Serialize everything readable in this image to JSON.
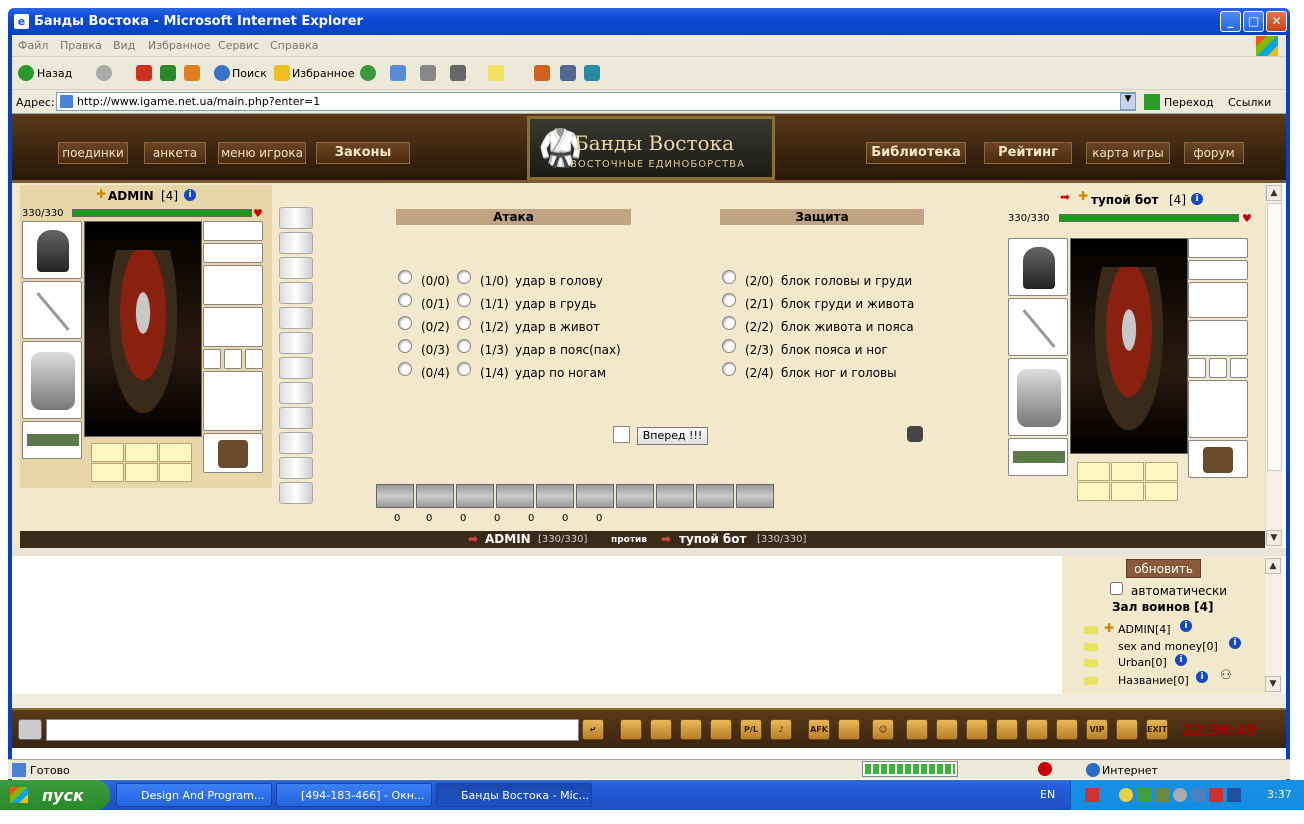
{
  "window": {
    "title": "Банды Востока - Microsoft Internet Explorer"
  },
  "menu": [
    "Файл",
    "Правка",
    "Вид",
    "Избранное",
    "Сервис",
    "Справка"
  ],
  "toolbar": {
    "back": "Назад",
    "search": "Поиск",
    "favorites": "Избранное"
  },
  "address": {
    "label": "Адрес:",
    "url": "http://www.igame.net.ua/main.php?enter=1",
    "go": "Переход",
    "links": "Ссылки"
  },
  "game_nav": {
    "left": [
      "поединки",
      "анкета",
      "меню игрока",
      "Законы"
    ],
    "right": [
      "Библиотека",
      "Рейтинг",
      "карта игры",
      "форум"
    ],
    "logo_title": "Банды Востока",
    "logo_sub": "ВОСТОЧНЫЕ ЕДИНОБОРСТВА"
  },
  "player": {
    "name": "ADMIN",
    "level": "[4]",
    "hp": "330/330",
    "hp_fraction": 1.0
  },
  "opponent": {
    "name": "тупой бот",
    "level": "[4]",
    "hp": "330/330",
    "hp_fraction": 1.0
  },
  "attack": {
    "header": "Атака",
    "rows": [
      {
        "code_a": "(0/0)",
        "code_b": "(1/0)",
        "label": "удар в голову"
      },
      {
        "code_a": "(0/1)",
        "code_b": "(1/1)",
        "label": "удар в грудь"
      },
      {
        "code_a": "(0/2)",
        "code_b": "(1/2)",
        "label": "удар в живот"
      },
      {
        "code_a": "(0/3)",
        "code_b": "(1/3)",
        "label": "удар в пояс(пах)"
      },
      {
        "code_a": "(0/4)",
        "code_b": "(1/4)",
        "label": "удар по ногам"
      }
    ]
  },
  "defense": {
    "header": "Защита",
    "rows": [
      {
        "code": "(2/0)",
        "label": "блок головы и груди"
      },
      {
        "code": "(2/1)",
        "label": "блок груди и живота"
      },
      {
        "code": "(2/2)",
        "label": "блок живота и пояса"
      },
      {
        "code": "(2/3)",
        "label": "блок пояса и ног"
      },
      {
        "code": "(2/4)",
        "label": "блок ног и головы"
      }
    ]
  },
  "forward_button": "Вперед !!!",
  "counters": [
    "0",
    "0",
    "0",
    "0",
    "0",
    "0",
    "0"
  ],
  "versus": {
    "p1": "ADMIN",
    "p1_hp": "[330/330]",
    "vs": "против",
    "p2": "тупой бот",
    "p2_hp": "[330/330]"
  },
  "online": {
    "refresh": "обновить",
    "auto": "автоматически",
    "hall": "Зал воинов [4]",
    "users": [
      "ADMIN[4]",
      "sex and money[0]",
      "Urban[0]",
      "Название[0]"
    ]
  },
  "clock": "22:36:49",
  "ie_status": {
    "ready": "Готово",
    "zone": "Интернет"
  },
  "taskbar": {
    "start": "пуск",
    "tasks": [
      "Design And Program...",
      "[494-183-466] - Окн...",
      "Банды Востока - Mic..."
    ],
    "lang": "EN",
    "time": "3:37"
  }
}
